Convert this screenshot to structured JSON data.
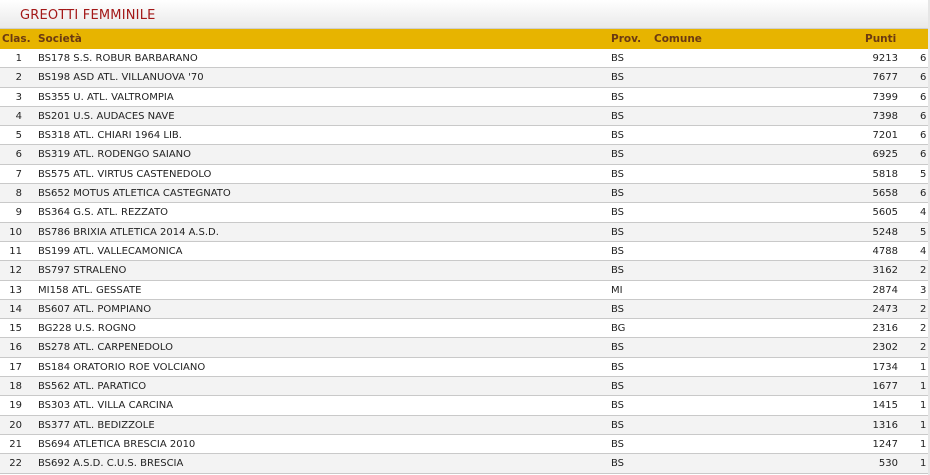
{
  "title": "GREOTTI FEMMINILE",
  "headers": {
    "clas": "Clas.",
    "societa": "Società",
    "prov": "Prov.",
    "comune": "Comune",
    "punti": "Punti"
  },
  "rows": [
    {
      "rank": "1",
      "societa": "BS178 S.S. ROBUR BARBARANO",
      "prov": "BS",
      "punti": "9213",
      "extra": "6"
    },
    {
      "rank": "2",
      "societa": "BS198 ASD ATL. VILLANUOVA '70",
      "prov": "BS",
      "punti": "7677",
      "extra": "6"
    },
    {
      "rank": "3",
      "societa": "BS355 U. ATL. VALTROMPIA",
      "prov": "BS",
      "punti": "7399",
      "extra": "6"
    },
    {
      "rank": "4",
      "societa": "BS201 U.S. AUDACES NAVE",
      "prov": "BS",
      "punti": "7398",
      "extra": "6"
    },
    {
      "rank": "5",
      "societa": "BS318 ATL. CHIARI 1964 LIB.",
      "prov": "BS",
      "punti": "7201",
      "extra": "6"
    },
    {
      "rank": "6",
      "societa": "BS319 ATL. RODENGO SAIANO",
      "prov": "BS",
      "punti": "6925",
      "extra": "6"
    },
    {
      "rank": "7",
      "societa": "BS575 ATL. VIRTUS CASTENEDOLO",
      "prov": "BS",
      "punti": "5818",
      "extra": "5"
    },
    {
      "rank": "8",
      "societa": "BS652 MOTUS ATLETICA CASTEGNATO",
      "prov": "BS",
      "punti": "5658",
      "extra": "6"
    },
    {
      "rank": "9",
      "societa": "BS364 G.S. ATL. REZZATO",
      "prov": "BS",
      "punti": "5605",
      "extra": "4"
    },
    {
      "rank": "10",
      "societa": "BS786 BRIXIA ATLETICA 2014 A.S.D.",
      "prov": "BS",
      "punti": "5248",
      "extra": "5"
    },
    {
      "rank": "11",
      "societa": "BS199 ATL. VALLECAMONICA",
      "prov": "BS",
      "punti": "4788",
      "extra": "4"
    },
    {
      "rank": "12",
      "societa": "BS797 STRALENO",
      "prov": "BS",
      "punti": "3162",
      "extra": "2"
    },
    {
      "rank": "13",
      "societa": "MI158 ATL. GESSATE",
      "prov": "MI",
      "punti": "2874",
      "extra": "3"
    },
    {
      "rank": "14",
      "societa": "BS607 ATL. POMPIANO",
      "prov": "BS",
      "punti": "2473",
      "extra": "2"
    },
    {
      "rank": "15",
      "societa": "BG228 U.S. ROGNO",
      "prov": "BG",
      "punti": "2316",
      "extra": "2"
    },
    {
      "rank": "16",
      "societa": "BS278 ATL. CARPENEDOLO",
      "prov": "BS",
      "punti": "2302",
      "extra": "2"
    },
    {
      "rank": "17",
      "societa": "BS184 ORATORIO ROE VOLCIANO",
      "prov": "BS",
      "punti": "1734",
      "extra": "1"
    },
    {
      "rank": "18",
      "societa": "BS562 ATL. PARATICO",
      "prov": "BS",
      "punti": "1677",
      "extra": "1"
    },
    {
      "rank": "19",
      "societa": "BS303 ATL. VILLA CARCINA",
      "prov": "BS",
      "punti": "1415",
      "extra": "1"
    },
    {
      "rank": "20",
      "societa": "BS377 ATL. BEDIZZOLE",
      "prov": "BS",
      "punti": "1316",
      "extra": "1"
    },
    {
      "rank": "21",
      "societa": "BS694 ATLETICA BRESCIA 2010",
      "prov": "BS",
      "punti": "1247",
      "extra": "1"
    },
    {
      "rank": "22",
      "societa": "BS692 A.S.D. C.U.S. BRESCIA",
      "prov": "BS",
      "punti": "530",
      "extra": "1"
    }
  ]
}
